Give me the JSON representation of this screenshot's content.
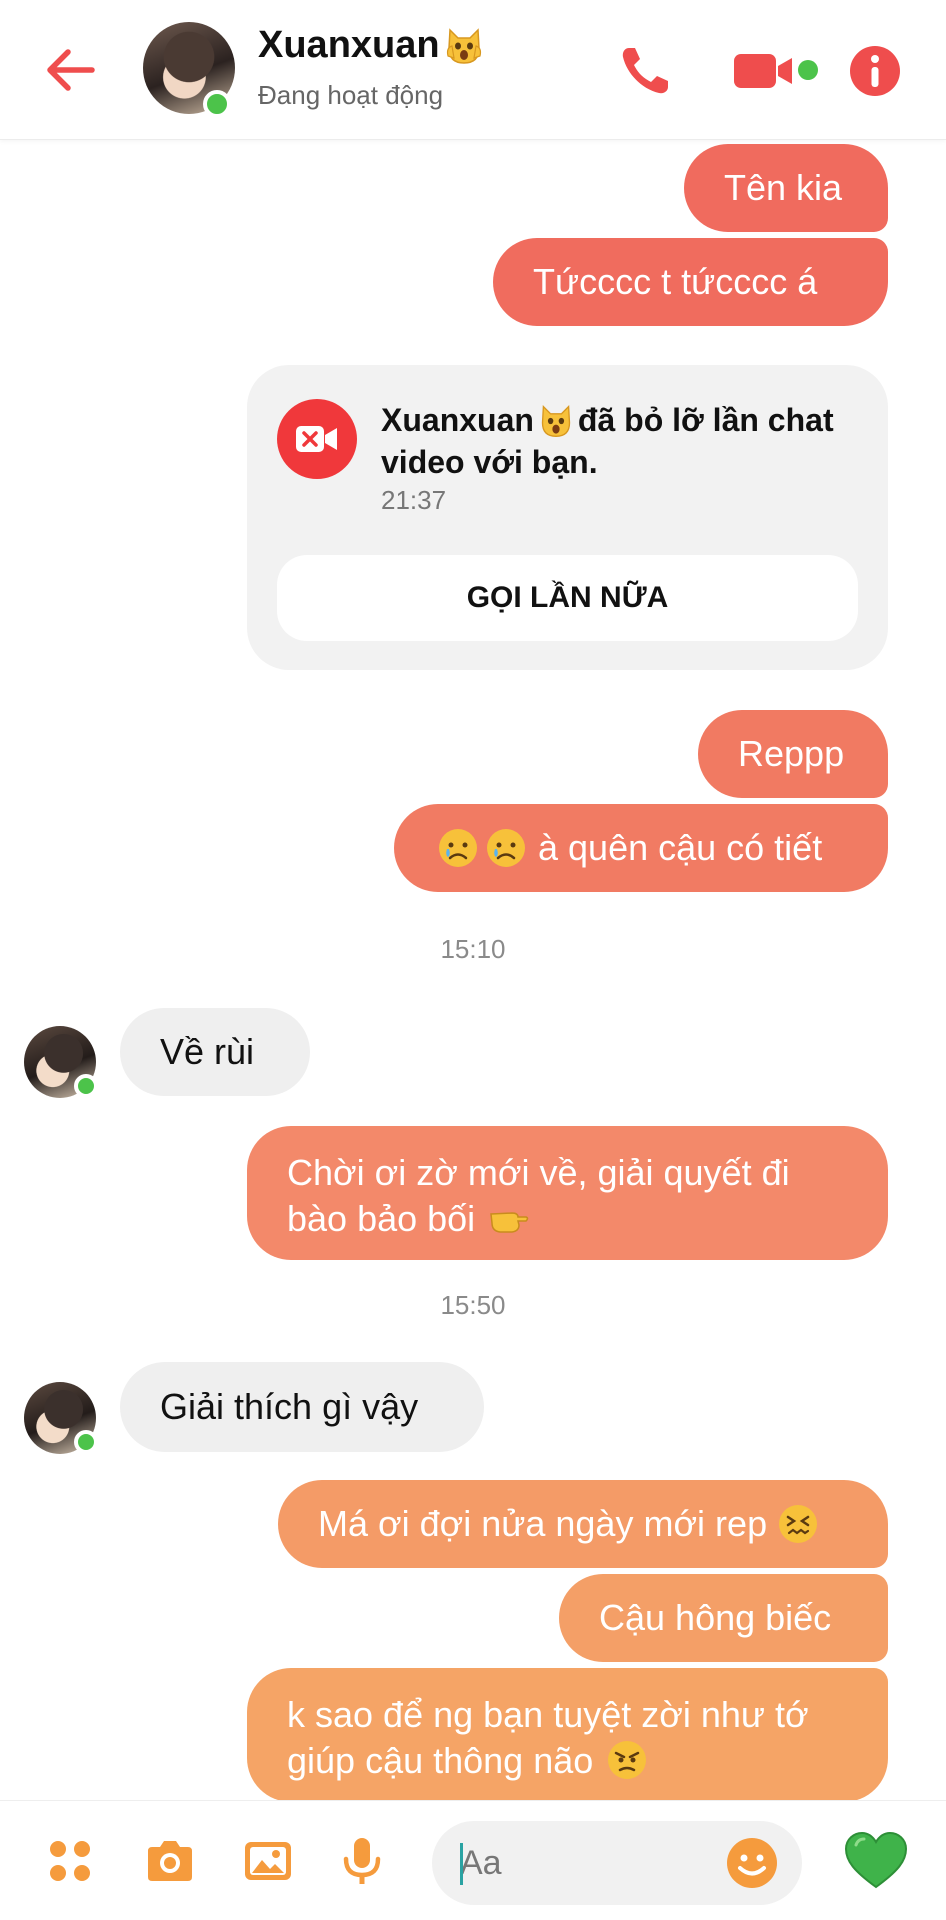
{
  "header": {
    "contact_name": "Xuanxuan",
    "status": "Đang hoạt động",
    "online_color": "#4cc34a",
    "icons": [
      "back-arrow-icon",
      "phone-icon",
      "video-camera-icon",
      "info-icon"
    ]
  },
  "messages": {
    "m1": "Tên kia",
    "m2": "Tứcccc t tứcccc á",
    "missed_call": {
      "name": "Xuanxuan",
      "text": "đã bỏ lỡ lần chat video với bạn.",
      "time": "21:37",
      "button": "GỌI LẦN NỮA"
    },
    "m3": "Reppp",
    "m4": "à quên cậu có tiết",
    "ts1": "15:10",
    "r1": "Về rùi",
    "m5": "Chời ơi zờ mới về, giải quyết đi bào bảo bối",
    "ts2": "15:50",
    "r2": "Giải thích gì vậy",
    "m6": "Má ơi đợi nửa ngày mới rep",
    "m7": "Cậu hông biếc",
    "m8": "k sao để ng bạn tuyệt zời như tớ giúp cậu thông não"
  },
  "composer": {
    "placeholder": "Aa",
    "icons": [
      "menu-dots-icon",
      "camera-icon",
      "gallery-icon",
      "microphone-icon",
      "emoji-icon",
      "heart-icon"
    ]
  },
  "colors": {
    "accent": "#f0514f",
    "bubble_gradient": [
      "#f06b5e",
      "#f3896a",
      "#f5a466"
    ],
    "received_bubble": "#efefef",
    "heart": "#3fb34a"
  }
}
